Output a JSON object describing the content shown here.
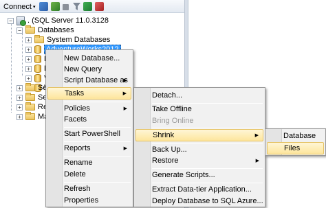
{
  "toolbar": {
    "connect_label": "Connect",
    "caret": "▾",
    "icons": [
      "connect-object-explorer-icon",
      "disconnect-icon",
      "stop-icon",
      "filter-icon",
      "refresh-icon",
      "clear-filter-icon"
    ]
  },
  "tree": {
    "server": {
      "expander": "−",
      "label": ". (SQL Server 11.0.3128"
    },
    "databases": {
      "expander": "−",
      "label": "Databases"
    },
    "system_databases": {
      "expander": "+",
      "label": "System Databases"
    },
    "selected_db": {
      "expander": "+",
      "label": "AdventureWorks2012"
    },
    "db_rows": [
      {
        "expander": "+",
        "label": "D"
      },
      {
        "expander": "+",
        "label": "D"
      },
      {
        "expander": "+",
        "label": "V"
      },
      {
        "expander": "+",
        "label": "V"
      }
    ],
    "security": {
      "expander": "+",
      "label": "Secu"
    },
    "server_objects": {
      "expander": "+",
      "label": "Serv"
    },
    "replication": {
      "expander": "+",
      "label": "Repl"
    },
    "management": {
      "expander": "+",
      "label": "Mar"
    }
  },
  "context_menu": {
    "new_database": "New Database...",
    "new_query": "New Query",
    "script_database_as": "Script Database as",
    "tasks": "Tasks",
    "policies": "Policies",
    "facets": "Facets",
    "start_powershell": "Start PowerShell",
    "reports": "Reports",
    "rename": "Rename",
    "delete": "Delete",
    "refresh": "Refresh",
    "properties": "Properties",
    "submenu_arrow": "▶"
  },
  "tasks_menu": {
    "detach": "Detach...",
    "take_offline": "Take Offline",
    "bring_online": "Bring Online",
    "shrink": "Shrink",
    "back_up": "Back Up...",
    "restore": "Restore",
    "generate_scripts": "Generate Scripts...",
    "extract_data_tier": "Extract Data-tier Application...",
    "deploy_sql_azure": "Deploy Database to SQL Azure..."
  },
  "shrink_menu": {
    "database": "Database",
    "files": "Files"
  }
}
